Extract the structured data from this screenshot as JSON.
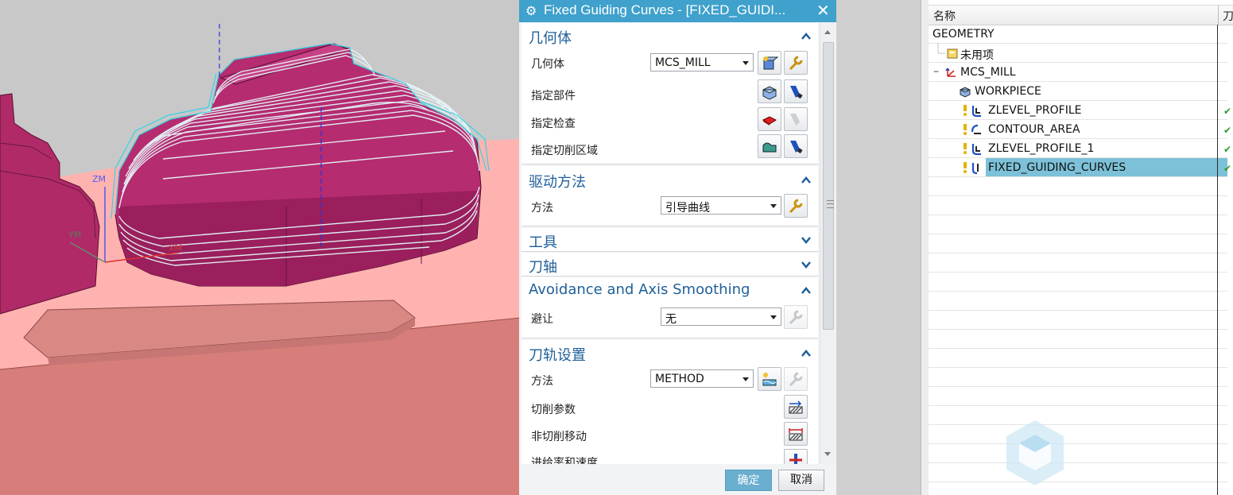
{
  "viewport": {
    "axis_labels": {
      "zm": "ZM",
      "ym": "YM",
      "xm": "XM"
    }
  },
  "dialog": {
    "title": "Fixed Guiding Curves - [FIXED_GUIDI...",
    "sections": {
      "geometry": {
        "header": "几何体",
        "geometry_label": "几何体",
        "geometry_value": "MCS_MILL",
        "specify_part": "指定部件",
        "specify_check": "指定检查",
        "specify_cut_area": "指定切削区域"
      },
      "drive_method": {
        "header": "驱动方法",
        "method_label": "方法",
        "method_value": "引导曲线"
      },
      "tool": {
        "header": "工具"
      },
      "tool_axis": {
        "header": "刀轴"
      },
      "avoidance": {
        "header": "Avoidance and Axis Smoothing",
        "avoid_label": "避让",
        "avoid_value": "无"
      },
      "path_settings": {
        "header": "刀轨设置",
        "method_label": "方法",
        "method_value": "METHOD",
        "cut_params": "切削参数",
        "non_cut_moves": "非切削移动",
        "feeds_speeds": "进给率和速度"
      }
    },
    "buttons": {
      "ok": "确定",
      "cancel": "取消"
    }
  },
  "navigator": {
    "column_name": "名称",
    "column_2": "刀",
    "items": [
      {
        "label": "GEOMETRY",
        "icon": "none"
      },
      {
        "label": "未用项",
        "icon": "unused-folder-icon"
      },
      {
        "label": "MCS_MILL",
        "icon": "mcs-icon"
      },
      {
        "label": "WORKPIECE",
        "icon": "workpiece-icon"
      },
      {
        "label": "ZLEVEL_PROFILE",
        "icon": "operation-icon"
      },
      {
        "label": "CONTOUR_AREA",
        "icon": "operation-icon"
      },
      {
        "label": "ZLEVEL_PROFILE_1",
        "icon": "operation-icon"
      },
      {
        "label": "FIXED_GUIDING_CURVES",
        "icon": "operation-icon"
      }
    ]
  }
}
